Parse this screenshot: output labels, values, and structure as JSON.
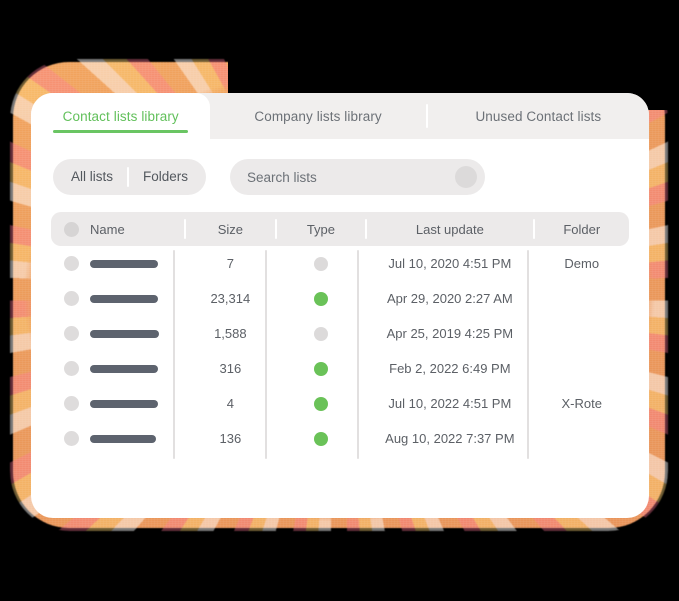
{
  "theme": {
    "frame_color": "#ea9a5c",
    "accent_green": "#6ac563",
    "tabbar_bg": "#f1efee",
    "control_bg": "#eceaea",
    "text_muted": "#5c6066",
    "bar_color": "#5d636e",
    "page_bg": "#000000"
  },
  "tabs": [
    {
      "label": "Contact lists library",
      "active": true
    },
    {
      "label": "Company lists library",
      "active": false
    },
    {
      "label": "Unused Contact lists",
      "active": false
    }
  ],
  "toolbar": {
    "segmented": [
      {
        "label": "All lists"
      },
      {
        "label": "Folders"
      }
    ],
    "search": {
      "placeholder": "Search lists",
      "value": "",
      "icon": "search-icon"
    }
  },
  "table": {
    "select_all_icon": "checkbox-circle-icon",
    "columns": [
      {
        "key": "name",
        "label": "Name"
      },
      {
        "key": "size",
        "label": "Size"
      },
      {
        "key": "type",
        "label": "Type"
      },
      {
        "key": "last_update",
        "label": "Last update"
      },
      {
        "key": "folder",
        "label": "Folder"
      }
    ],
    "rows": [
      {
        "name_redacted": true,
        "name_bar_width": 68,
        "size": "7",
        "type_dot": "grey",
        "last_update": "Jul 10, 2020 4:51 PM",
        "folder": "Demo"
      },
      {
        "name_redacted": true,
        "name_bar_width": 68,
        "size": "23,314",
        "type_dot": "green",
        "last_update": "Apr 29, 2020 2:27 AM",
        "folder": ""
      },
      {
        "name_redacted": true,
        "name_bar_width": 69,
        "size": "1,588",
        "type_dot": "grey",
        "last_update": "Apr 25, 2019 4:25 PM",
        "folder": ""
      },
      {
        "name_redacted": true,
        "name_bar_width": 68,
        "size": "316",
        "type_dot": "green",
        "last_update": "Feb 2, 2022 6:49 PM",
        "folder": ""
      },
      {
        "name_redacted": true,
        "name_bar_width": 68,
        "size": "4",
        "type_dot": "green",
        "last_update": "Jul 10, 2022 4:51 PM",
        "folder": "X-Rote"
      },
      {
        "name_redacted": true,
        "name_bar_width": 66,
        "size": "136",
        "type_dot": "green",
        "last_update": "Aug 10, 2022 7:37 PM",
        "folder": ""
      }
    ],
    "dot_colors": {
      "grey": "#dcdada",
      "green": "#6ac258"
    }
  }
}
